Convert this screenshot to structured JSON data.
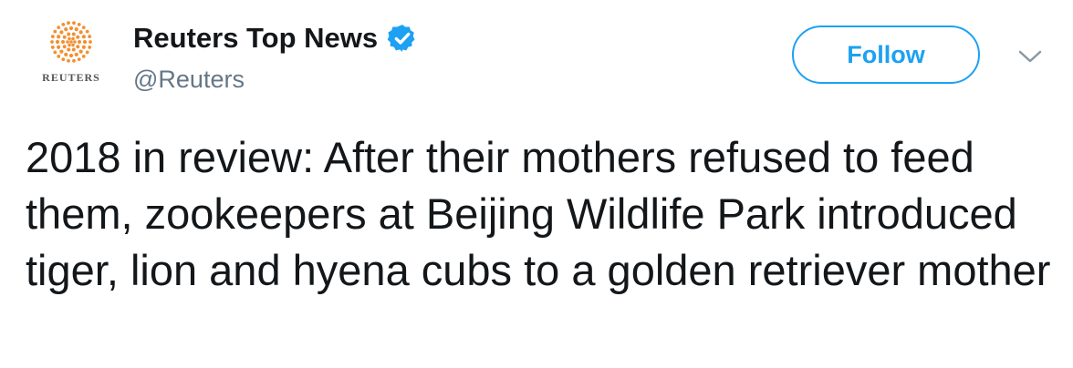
{
  "account": {
    "avatar_logo": "reuters-logo",
    "avatar_wordmark": "REUTERS",
    "display_name": "Reuters Top News",
    "handle": "@Reuters",
    "verified_icon": "verified-badge-icon"
  },
  "actions": {
    "follow_label": "Follow",
    "menu_icon": "chevron-down-icon"
  },
  "tweet": {
    "text": "2018 in review: After their mothers refused to feed them, zookeepers at Beijing Wildlife Park introduced tiger, lion and hyena cubs to a golden retriever mother"
  },
  "colors": {
    "accent": "#1da1f2",
    "handle": "#657786",
    "text": "#14171a",
    "logo_orange": "#f29031"
  }
}
